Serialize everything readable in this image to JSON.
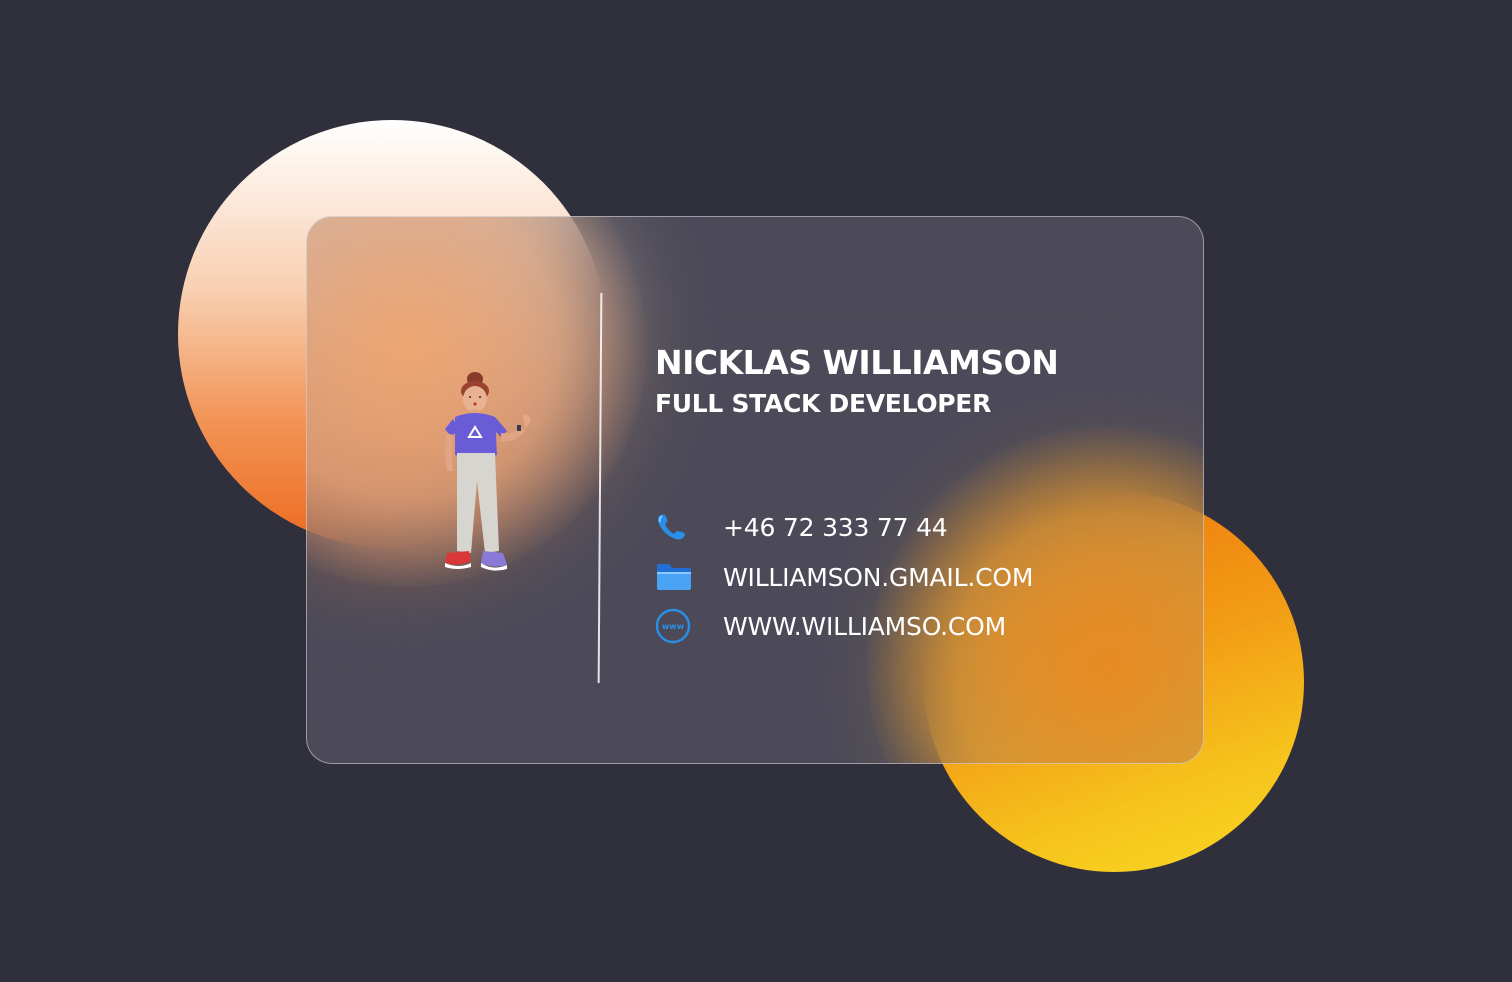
{
  "card": {
    "name": "NICKLAS WILLIAMSON",
    "role": "FULL STACK DEVELOPER",
    "contacts": [
      {
        "icon": "phone-icon",
        "text": "+46 72 333 77 44"
      },
      {
        "icon": "folder-icon",
        "text": "WILLIAMSON.GMAIL.COM"
      },
      {
        "icon": "web-icon",
        "text": "WWW.WILLIAMSO.COM"
      }
    ]
  },
  "colors": {
    "background": "#302f3c",
    "accent_orange": "#ec7010",
    "accent_yellow": "#f8da24",
    "icon_blue": "#2a8fe8"
  }
}
